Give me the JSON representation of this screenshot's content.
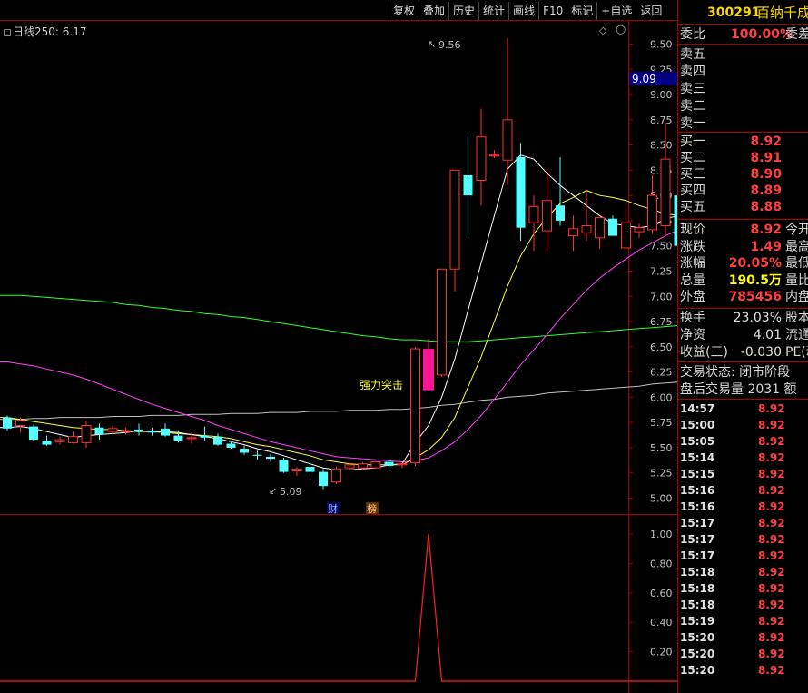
{
  "toolbar": [
    "复权",
    "叠加",
    "历史",
    "统计",
    "画线",
    "F10",
    "标记",
    "+自选",
    "返回"
  ],
  "chart": {
    "title": "日线250: 6.17",
    "price_axis": [
      "9.50",
      "9.25",
      "9.00",
      "8.75",
      "8.50",
      "8.25",
      "8.00",
      "7.75",
      "7.50",
      "7.25",
      "7.00",
      "6.75",
      "6.50",
      "6.25",
      "6.00",
      "5.75",
      "5.50",
      "5.25",
      "5.00"
    ],
    "highlight_price": "9.09",
    "high_label": "9.56",
    "low_label": "5.09",
    "signal_label": "强力突击",
    "event_tags": [
      "财",
      "榜"
    ],
    "indicator_axis": [
      "1.00",
      "0.80",
      "0.60",
      "0.40",
      "0.20"
    ],
    "colors": {
      "up": "#ff3030",
      "down": "#54ffff",
      "ma_white": "#ffffff",
      "ma_yellow": "#ffff40",
      "ma_magenta": "#ff40ff",
      "ma_green": "#30ff30",
      "ma_gray": "#c0c0c0",
      "signal_bar": "#ff1493"
    }
  },
  "quote": {
    "code": "300291",
    "name": "百纳千成",
    "weibi_label": "委比",
    "weibi_value": "100.00%",
    "weicha_label": "委差",
    "sells": [
      "卖五",
      "卖四",
      "卖三",
      "卖二",
      "卖一"
    ],
    "buys": [
      {
        "label": "买一",
        "price": "8.92"
      },
      {
        "label": "买二",
        "price": "8.91"
      },
      {
        "label": "买三",
        "price": "8.90"
      },
      {
        "label": "买四",
        "price": "8.89"
      },
      {
        "label": "买五",
        "price": "8.88"
      }
    ],
    "stats": [
      {
        "label": "现价",
        "value": "8.92",
        "color": "red",
        "right": "今开"
      },
      {
        "label": "涨跌",
        "value": "1.49",
        "color": "red",
        "right": "最高"
      },
      {
        "label": "涨幅",
        "value": "20.05%",
        "color": "red",
        "right": "最低"
      },
      {
        "label": "总量",
        "value": "190.5万",
        "color": "yellow",
        "right": "量比"
      },
      {
        "label": "外盘",
        "value": "785456",
        "color": "red",
        "right": "内盘"
      }
    ],
    "stats2": [
      {
        "label": "换手",
        "value": "23.03%",
        "right": "股本"
      },
      {
        "label": "净资",
        "value": "4.01",
        "right": "流通"
      },
      {
        "label": "收益(三)",
        "value": "-0.030",
        "right": "PE(动"
      }
    ],
    "trade_status": "交易状态: 闭市阶段",
    "after_hours": "盘后交易量 2031 额",
    "ticks": [
      {
        "time": "14:57",
        "price": "8.92"
      },
      {
        "time": "15:00",
        "price": "8.92"
      },
      {
        "time": "15:05",
        "price": "8.92"
      },
      {
        "time": "15:14",
        "price": "8.92"
      },
      {
        "time": "15:15",
        "price": "8.92"
      },
      {
        "time": "15:16",
        "price": "8.92"
      },
      {
        "time": "15:16",
        "price": "8.92"
      },
      {
        "time": "15:17",
        "price": "8.92"
      },
      {
        "time": "15:17",
        "price": "8.92"
      },
      {
        "time": "15:17",
        "price": "8.92"
      },
      {
        "time": "15:18",
        "price": "8.92"
      },
      {
        "time": "15:18",
        "price": "8.92"
      },
      {
        "time": "15:18",
        "price": "8.92"
      },
      {
        "time": "15:19",
        "price": "8.92"
      },
      {
        "time": "15:20",
        "price": "8.92"
      },
      {
        "time": "15:20",
        "price": "8.92"
      },
      {
        "time": "15:20",
        "price": "8.92"
      }
    ]
  },
  "chart_data": {
    "type": "candlestick",
    "candles": [
      {
        "o": 5.8,
        "h": 5.82,
        "l": 5.67,
        "c": 5.69
      },
      {
        "o": 5.72,
        "h": 5.8,
        "l": 5.65,
        "c": 5.77
      },
      {
        "o": 5.71,
        "h": 5.73,
        "l": 5.57,
        "c": 5.58
      },
      {
        "o": 5.57,
        "h": 5.62,
        "l": 5.52,
        "c": 5.53
      },
      {
        "o": 5.56,
        "h": 5.61,
        "l": 5.53,
        "c": 5.58
      },
      {
        "o": 5.55,
        "h": 5.66,
        "l": 5.54,
        "c": 5.61
      },
      {
        "o": 5.55,
        "h": 5.77,
        "l": 5.5,
        "c": 5.72
      },
      {
        "o": 5.7,
        "h": 5.74,
        "l": 5.58,
        "c": 5.63
      },
      {
        "o": 5.66,
        "h": 5.72,
        "l": 5.63,
        "c": 5.69
      },
      {
        "o": 5.66,
        "h": 5.7,
        "l": 5.63,
        "c": 5.67
      },
      {
        "o": 5.68,
        "h": 5.74,
        "l": 5.62,
        "c": 5.66
      },
      {
        "o": 5.67,
        "h": 5.7,
        "l": 5.62,
        "c": 5.65
      },
      {
        "o": 5.69,
        "h": 5.74,
        "l": 5.61,
        "c": 5.62
      },
      {
        "o": 5.62,
        "h": 5.66,
        "l": 5.55,
        "c": 5.57
      },
      {
        "o": 5.59,
        "h": 5.65,
        "l": 5.54,
        "c": 5.6
      },
      {
        "o": 5.62,
        "h": 5.71,
        "l": 5.57,
        "c": 5.6
      },
      {
        "o": 5.61,
        "h": 5.64,
        "l": 5.52,
        "c": 5.53
      },
      {
        "o": 5.54,
        "h": 5.57,
        "l": 5.49,
        "c": 5.5
      },
      {
        "o": 5.49,
        "h": 5.52,
        "l": 5.43,
        "c": 5.45
      },
      {
        "o": 5.43,
        "h": 5.47,
        "l": 5.38,
        "c": 5.42
      },
      {
        "o": 5.41,
        "h": 5.44,
        "l": 5.36,
        "c": 5.39
      },
      {
        "o": 5.38,
        "h": 5.4,
        "l": 5.25,
        "c": 5.26
      },
      {
        "o": 5.27,
        "h": 5.31,
        "l": 5.22,
        "c": 5.29
      },
      {
        "o": 5.31,
        "h": 5.37,
        "l": 5.24,
        "c": 5.26
      },
      {
        "o": 5.26,
        "h": 5.29,
        "l": 5.09,
        "c": 5.12
      },
      {
        "o": 5.16,
        "h": 5.31,
        "l": 5.14,
        "c": 5.29
      },
      {
        "o": 5.3,
        "h": 5.35,
        "l": 5.28,
        "c": 5.33
      },
      {
        "o": 5.3,
        "h": 5.36,
        "l": 5.28,
        "c": 5.34
      },
      {
        "o": 5.3,
        "h": 5.37,
        "l": 5.29,
        "c": 5.36
      },
      {
        "o": 5.36,
        "h": 5.38,
        "l": 5.28,
        "c": 5.32
      },
      {
        "o": 5.33,
        "h": 5.35,
        "l": 5.3,
        "c": 5.34
      },
      {
        "o": 5.35,
        "h": 6.5,
        "l": 5.32,
        "c": 6.48
      },
      {
        "o": 6.48,
        "h": 6.58,
        "l": 6.06,
        "c": 6.07
      },
      {
        "o": 6.22,
        "h": 7.27,
        "l": 6.2,
        "c": 7.27
      },
      {
        "o": 7.27,
        "h": 8.25,
        "l": 7.05,
        "c": 8.25
      },
      {
        "o": 8.2,
        "h": 8.62,
        "l": 7.6,
        "c": 8.0
      },
      {
        "o": 8.15,
        "h": 8.86,
        "l": 7.9,
        "c": 8.58
      },
      {
        "o": 8.39,
        "h": 8.45,
        "l": 8.37,
        "c": 8.4
      },
      {
        "o": 8.35,
        "h": 9.56,
        "l": 8.1,
        "c": 8.75
      },
      {
        "o": 8.38,
        "h": 8.52,
        "l": 7.55,
        "c": 7.68
      },
      {
        "o": 7.73,
        "h": 8.0,
        "l": 7.45,
        "c": 7.89
      },
      {
        "o": 7.65,
        "h": 8.25,
        "l": 7.45,
        "c": 7.95
      },
      {
        "o": 7.9,
        "h": 8.38,
        "l": 7.7,
        "c": 7.75
      },
      {
        "o": 7.6,
        "h": 7.8,
        "l": 7.45,
        "c": 7.67
      },
      {
        "o": 7.63,
        "h": 8.05,
        "l": 7.55,
        "c": 7.7
      },
      {
        "o": 7.58,
        "h": 7.75,
        "l": 7.47,
        "c": 7.78
      },
      {
        "o": 7.77,
        "h": 7.8,
        "l": 7.6,
        "c": 7.6
      },
      {
        "o": 7.48,
        "h": 7.9,
        "l": 7.46,
        "c": 7.73
      },
      {
        "o": 7.64,
        "h": 7.72,
        "l": 7.58,
        "c": 7.68
      },
      {
        "o": 7.66,
        "h": 8.2,
        "l": 7.62,
        "c": 8.0
      },
      {
        "o": 7.7,
        "h": 8.72,
        "l": 7.6,
        "c": 8.36
      },
      {
        "o": 8.0,
        "h": 8.2,
        "l": 7.38,
        "c": 7.5
      },
      {
        "o": 7.45,
        "h": 8.92,
        "l": 7.43,
        "c": 8.92
      }
    ],
    "ma_white": [
      5.7,
      5.71,
      5.69,
      5.66,
      5.63,
      5.6,
      5.62,
      5.63,
      5.64,
      5.65,
      5.67,
      5.66,
      5.66,
      5.65,
      5.63,
      5.61,
      5.59,
      5.56,
      5.53,
      5.49,
      5.46,
      5.42,
      5.38,
      5.34,
      5.3,
      5.28,
      5.28,
      5.29,
      5.3,
      5.33,
      5.34,
      5.55,
      5.72,
      6.0,
      6.38,
      6.86,
      7.33,
      7.8,
      8.26,
      8.4,
      8.36,
      8.22,
      8.1,
      8.0,
      7.9,
      7.8,
      7.72,
      7.7,
      7.68,
      7.7,
      7.77,
      7.8,
      8.05
    ],
    "ma_yellow": [
      5.8,
      5.78,
      5.76,
      5.74,
      5.72,
      5.7,
      5.69,
      5.68,
      5.68,
      5.67,
      5.66,
      5.66,
      5.65,
      5.64,
      5.63,
      5.62,
      5.61,
      5.59,
      5.56,
      5.53,
      5.51,
      5.48,
      5.45,
      5.42,
      5.38,
      5.36,
      5.34,
      5.33,
      5.33,
      5.33,
      5.33,
      5.4,
      5.48,
      5.6,
      5.8,
      6.1,
      6.4,
      6.75,
      7.1,
      7.4,
      7.62,
      7.78,
      7.92,
      7.98,
      8.05,
      8.0,
      7.98,
      7.95,
      7.9,
      7.86,
      7.82,
      7.8,
      7.85
    ],
    "ma_magenta": [
      6.35,
      6.33,
      6.31,
      6.28,
      6.25,
      6.22,
      6.18,
      6.13,
      6.08,
      6.03,
      5.98,
      5.93,
      5.89,
      5.85,
      5.81,
      5.77,
      5.72,
      5.68,
      5.64,
      5.6,
      5.56,
      5.53,
      5.5,
      5.47,
      5.44,
      5.41,
      5.4,
      5.39,
      5.38,
      5.37,
      5.36,
      5.37,
      5.4,
      5.47,
      5.56,
      5.68,
      5.82,
      5.98,
      6.15,
      6.32,
      6.47,
      6.62,
      6.78,
      6.92,
      7.06,
      7.18,
      7.28,
      7.37,
      7.46,
      7.53,
      7.6,
      7.66,
      7.76
    ],
    "ma_green": [
      7.01,
      7.01,
      7.0,
      6.99,
      6.98,
      6.97,
      6.96,
      6.95,
      6.94,
      6.92,
      6.91,
      6.89,
      6.88,
      6.86,
      6.85,
      6.83,
      6.82,
      6.8,
      6.79,
      6.77,
      6.75,
      6.73,
      6.71,
      6.69,
      6.67,
      6.65,
      6.63,
      6.61,
      6.6,
      6.58,
      6.57,
      6.57,
      6.56,
      6.55,
      6.55,
      6.55,
      6.56,
      6.57,
      6.58,
      6.59,
      6.6,
      6.61,
      6.62,
      6.63,
      6.64,
      6.65,
      6.66,
      6.67,
      6.68,
      6.69,
      6.7,
      6.71,
      6.74
    ],
    "ma_gray": [
      5.78,
      5.78,
      5.79,
      5.79,
      5.8,
      5.8,
      5.8,
      5.8,
      5.81,
      5.81,
      5.81,
      5.82,
      5.82,
      5.82,
      5.83,
      5.83,
      5.83,
      5.84,
      5.84,
      5.84,
      5.85,
      5.85,
      5.85,
      5.86,
      5.86,
      5.86,
      5.87,
      5.87,
      5.87,
      5.88,
      5.88,
      5.89,
      5.9,
      5.92,
      5.93,
      5.95,
      5.97,
      5.98,
      6.0,
      6.01,
      6.02,
      6.04,
      6.05,
      6.06,
      6.07,
      6.08,
      6.09,
      6.1,
      6.11,
      6.13,
      6.14,
      6.15,
      6.17
    ],
    "indicator": [
      0,
      0,
      0,
      0,
      0,
      0,
      0,
      0,
      0,
      0,
      0,
      0,
      0,
      0,
      0,
      0,
      0,
      0,
      0,
      0,
      0,
      0,
      0,
      0,
      0,
      0,
      0,
      0,
      0,
      0,
      0,
      0,
      1,
      0,
      0,
      0,
      0,
      0,
      0,
      0,
      0,
      0,
      0,
      0,
      0,
      0,
      0,
      0,
      0,
      0,
      0,
      0,
      0
    ],
    "ylim": [
      4.95,
      9.75
    ],
    "indicator_ylim": [
      0,
      1.1
    ]
  }
}
